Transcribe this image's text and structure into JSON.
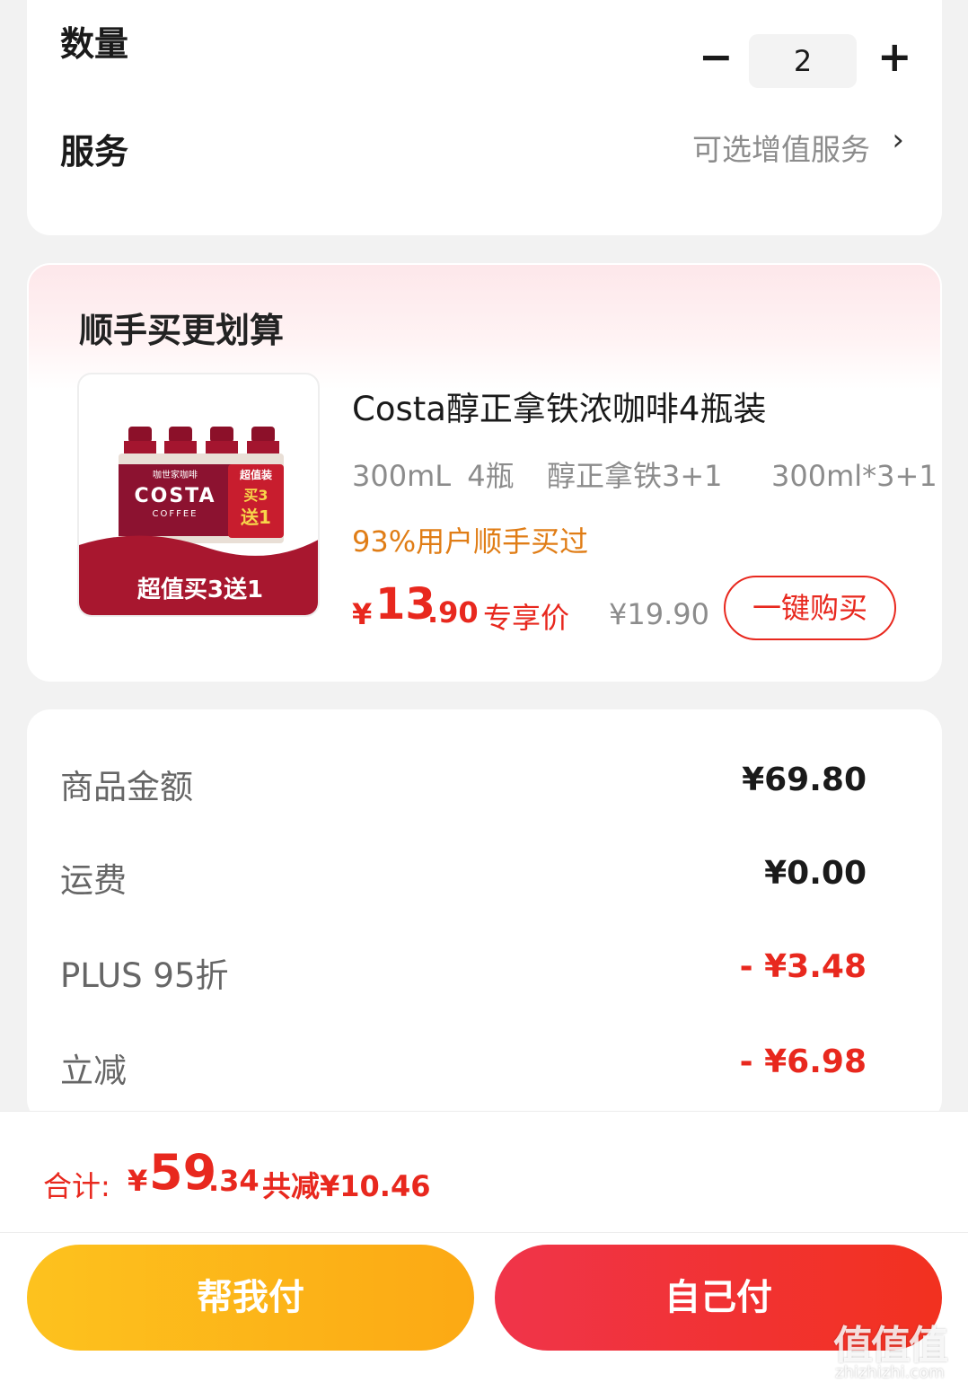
{
  "options": {
    "quantity_label": "数量",
    "quantity_minus": "−",
    "quantity_value": "2",
    "quantity_plus": "+",
    "service_label": "服务",
    "service_hint": "可选增值服务",
    "service_chevron": "›"
  },
  "recommendation": {
    "title": "顺手买更划算",
    "product": {
      "name": "Costa醇正拿铁浓咖啡4瓶装",
      "spec": "300mL 4瓶  醇正拿铁3+1   300ml*3+1",
      "social_proof": "93%用户顺手买过",
      "price_symbol": "¥",
      "price_int": "13",
      "price_dec": ".90",
      "price_tag": "专享价",
      "original_price": "¥19.90",
      "buy_button": "一键购买",
      "image": {
        "brand": "COSTA",
        "sub_brand": "COFFEE",
        "top_text": "咖世家咖啡",
        "badge_top": "超值装",
        "badge_buy": "买3",
        "badge_gift": "送1",
        "banner": "超值买3送1"
      }
    }
  },
  "amounts": {
    "items": [
      {
        "label": "商品金额",
        "value": "¥69.80"
      },
      {
        "label": "运费",
        "value": "¥0.00"
      },
      {
        "label": "PLUS 95折",
        "value": "- ¥3.48"
      },
      {
        "label": "立减",
        "value": "- ¥6.98"
      }
    ]
  },
  "footer": {
    "total_label": "合计:",
    "total_symbol": "¥",
    "total_int": "59",
    "total_dec": ".34",
    "saved": "共减¥10.46",
    "help_pay": "帮我付",
    "self_pay": "自己付"
  },
  "watermark": {
    "logo": "值值值",
    "url": "zhizhizhi.com"
  },
  "colors": {
    "accent_red": "#e8281e",
    "orange": "#e07d16",
    "yellow_button": "#fdc21e",
    "red_button": "#f0344a"
  }
}
